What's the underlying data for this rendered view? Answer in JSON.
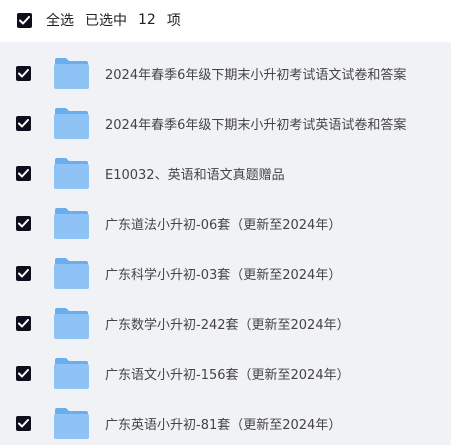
{
  "header": {
    "select_all_label": "全选",
    "selected_label": "已选中",
    "selected_count": "12",
    "count_unit": "项"
  },
  "colors": {
    "checkbox": "#0e0e1c",
    "folder_front": "#8fc3f6",
    "folder_back": "#6aaef0",
    "list_background": "#f1f2f6"
  },
  "icons": {
    "checkbox": "checkmark-icon",
    "folder": "folder-icon"
  },
  "files": [
    {
      "name": "2024年春季6年级下期末小升初考试语文试卷和答案",
      "checked": true
    },
    {
      "name": "2024年春季6年级下期末小升初考试英语试卷和答案",
      "checked": true
    },
    {
      "name": "E10032、英语和语文真题赠品",
      "checked": true
    },
    {
      "name": "广东道法小升初-06套（更新至2024年）",
      "checked": true
    },
    {
      "name": "广东科学小升初-03套（更新至2024年）",
      "checked": true
    },
    {
      "name": "广东数学小升初-242套（更新至2024年）",
      "checked": true
    },
    {
      "name": "广东语文小升初-156套（更新至2024年）",
      "checked": true
    },
    {
      "name": "广东英语小升初-81套（更新至2024年）",
      "checked": true
    }
  ]
}
